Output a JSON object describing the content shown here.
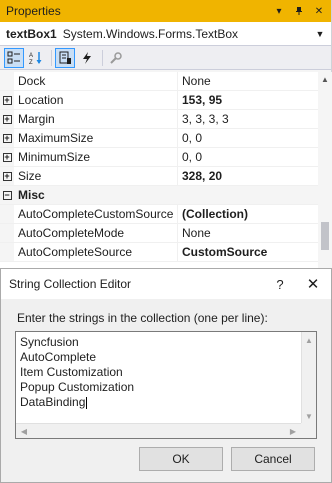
{
  "properties_panel": {
    "title": "Properties",
    "title_buttons": [
      "▾",
      "📌",
      "✕"
    ],
    "object_name": "textBox1",
    "object_type": "System.Windows.Forms.TextBox",
    "toolbar_icons": [
      "categorized-icon",
      "alphabetical-icon",
      "properties-icon",
      "events-icon",
      "property-pages-icon"
    ],
    "rows": [
      {
        "expander": "",
        "name": "Dock",
        "value": "None",
        "bold": false
      },
      {
        "expander": "+",
        "name": "Location",
        "value": "153, 95",
        "bold": true
      },
      {
        "expander": "+",
        "name": "Margin",
        "value": "3, 3, 3, 3",
        "bold": false
      },
      {
        "expander": "+",
        "name": "MaximumSize",
        "value": "0, 0",
        "bold": false
      },
      {
        "expander": "+",
        "name": "MinimumSize",
        "value": "0, 0",
        "bold": false
      },
      {
        "expander": "+",
        "name": "Size",
        "value": "328, 20",
        "bold": true
      },
      {
        "expander": "−",
        "name": "Misc",
        "value": "",
        "category": true
      },
      {
        "expander": "",
        "name": "AutoCompleteCustomSource",
        "value": "(Collection)",
        "bold": true
      },
      {
        "expander": "",
        "name": "AutoCompleteMode",
        "value": "None",
        "bold": false
      },
      {
        "expander": "",
        "name": "AutoCompleteSource",
        "value": "CustomSource",
        "bold": true
      }
    ]
  },
  "dialog": {
    "title": "String Collection Editor",
    "help": "?",
    "close": "✕",
    "prompt": "Enter the strings in the collection (one per line):",
    "lines": [
      "Syncfusion",
      "AutoComplete",
      "Item Customization",
      "Popup Customization",
      "DataBinding"
    ],
    "ok_label": "OK",
    "cancel_label": "Cancel"
  },
  "colors": {
    "title_bar": "#f0b400",
    "selected_tool": "#c9def5"
  }
}
